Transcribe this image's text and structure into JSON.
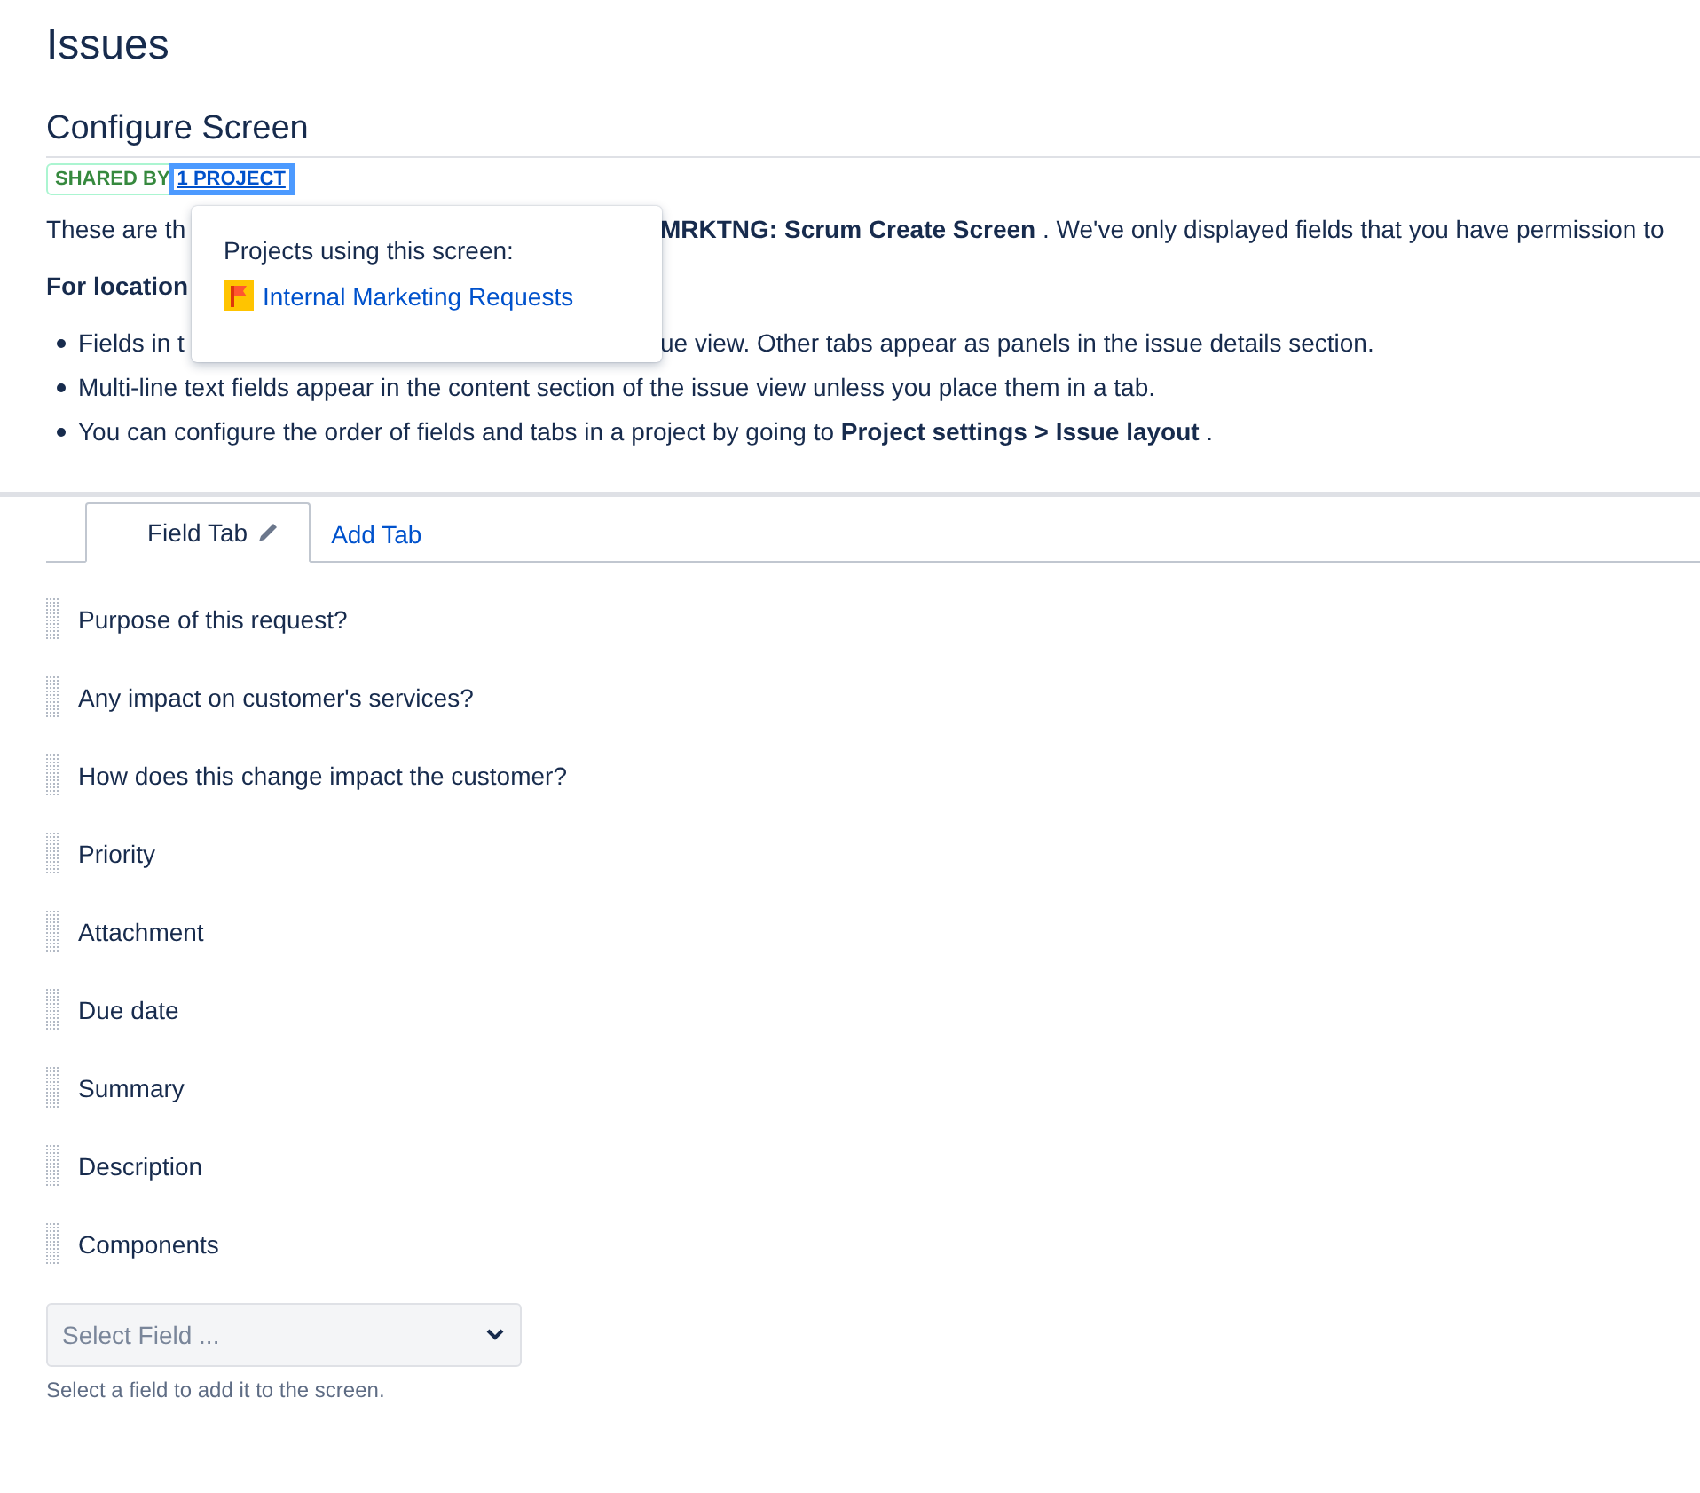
{
  "page_title": "Issues",
  "section_title": "Configure Screen",
  "lozenge": {
    "label": "SHARED BY",
    "link": "1 PROJECT",
    "focused": true
  },
  "intro_lines": [
    {
      "kind": "plain",
      "left": "These are th",
      "right": "**MRKTNG: Scrum Create Screen** . We've only displayed fields that you have permission to"
    },
    {
      "kind": "heading",
      "left": "For location"
    },
    {
      "kind": "bullet",
      "left": "Fields in t",
      "right": "ue view. Other tabs appear as panels in the issue details section."
    },
    {
      "kind": "bullet",
      "left": "Multi-line text fields appear in the content section of the issue view unless you place them in a tab."
    },
    {
      "kind": "bullet",
      "left": "You can configure the order of fields and tabs in a project by going to **Project settings > Issue layout** ."
    }
  ],
  "popover": {
    "title": "Projects using this screen:",
    "projects": [
      {
        "name": "Internal Marketing Requests"
      }
    ]
  },
  "tabs": [
    {
      "kind": "tab",
      "label": "Field Tab",
      "selected": true
    },
    {
      "kind": "add",
      "label": "Add Tab",
      "selected": false
    }
  ],
  "fields": [
    "Purpose of this request?",
    "Any impact on customer's services?",
    "How does this change impact the customer?",
    "Priority",
    "Attachment",
    "Due date",
    "Summary",
    "Description",
    "Components"
  ],
  "select": {
    "placeholder": "Select Field ...",
    "hint": "Select a field to add it to the screen."
  }
}
